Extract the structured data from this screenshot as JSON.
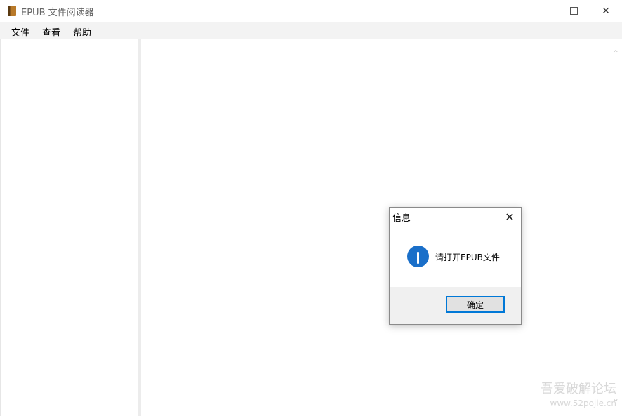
{
  "window": {
    "title": "EPUB 文件阅读器",
    "min_glyph": "",
    "close_glyph": "✕"
  },
  "menu": [
    "文件",
    "查看",
    "帮助"
  ],
  "scrollbar": {
    "up": "⌃",
    "down": "⌄"
  },
  "watermark": {
    "line1": "吾爱破解论坛",
    "line2": "www.52pojie.cn"
  },
  "dialog": {
    "title": "信息",
    "message": "请打开EPUB文件",
    "ok_label": "确定",
    "close_glyph": "✕",
    "icon": "info-icon"
  }
}
